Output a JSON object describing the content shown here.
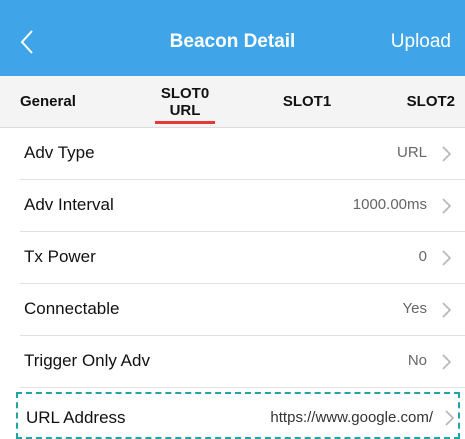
{
  "nav": {
    "title": "Beacon Detail",
    "action": "Upload",
    "back_icon": "chevron-left-icon"
  },
  "tabs": [
    {
      "label": "General"
    },
    {
      "label": "SLOT0",
      "sublabel": "URL",
      "active": true
    },
    {
      "label": "SLOT1"
    },
    {
      "label": "SLOT2"
    }
  ],
  "rows": [
    {
      "label": "Adv Type",
      "value": "URL"
    },
    {
      "label": "Adv Interval",
      "value": "1000.00ms"
    },
    {
      "label": "Tx Power",
      "value": "0"
    },
    {
      "label": "Connectable",
      "value": "Yes"
    },
    {
      "label": "Trigger Only Adv",
      "value": "No"
    },
    {
      "label": "URL Address",
      "value": "https://www.google.com/"
    }
  ],
  "colors": {
    "nav_bg": "#3fa5e8",
    "tab_bg": "#f4f4f4",
    "active_underline": "#e53935",
    "highlight_border": "#20a4a4"
  }
}
